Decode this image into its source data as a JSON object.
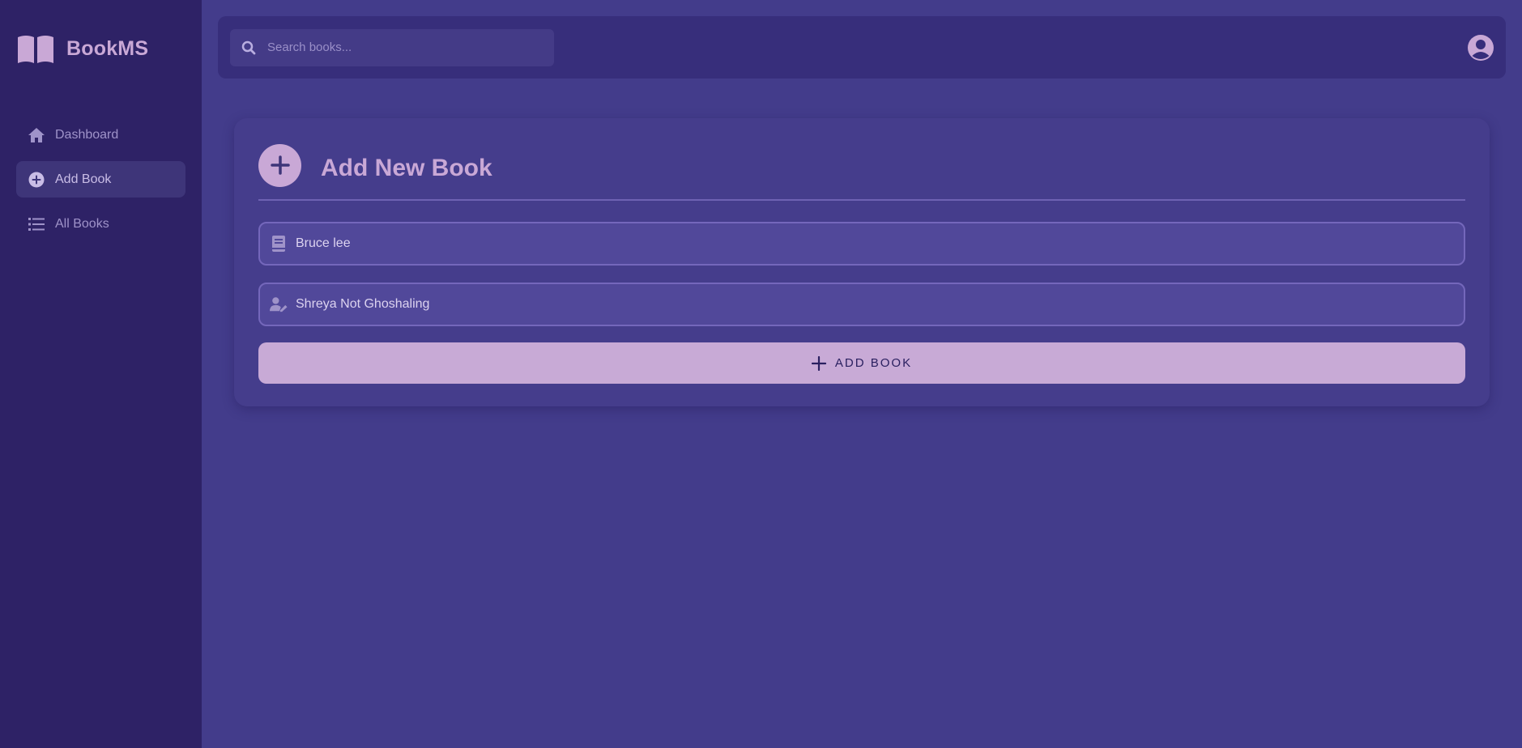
{
  "sidebar": {
    "brand": "BookMS",
    "items": [
      {
        "label": "Dashboard",
        "icon": "home-icon",
        "active": false
      },
      {
        "label": "Add Book",
        "icon": "plus-circle-icon",
        "active": true
      },
      {
        "label": "All Books",
        "icon": "list-icon",
        "active": false
      }
    ]
  },
  "topbar": {
    "search_placeholder": "Search books...",
    "search_value": ""
  },
  "form": {
    "title": "Add New Book",
    "title_field": {
      "value": "Bruce lee",
      "icon": "book-icon"
    },
    "author_field": {
      "value": "Shreya Not Ghoshaling",
      "icon": "user-pen-icon"
    },
    "submit_label": "ADD BOOK"
  },
  "colors": {
    "sidebar_bg": "#2e2266",
    "main_bg": "#433c8b",
    "accent": "#c9a8d6",
    "topbar_bg": "#372e7b",
    "card_bg": "#453d8c"
  }
}
